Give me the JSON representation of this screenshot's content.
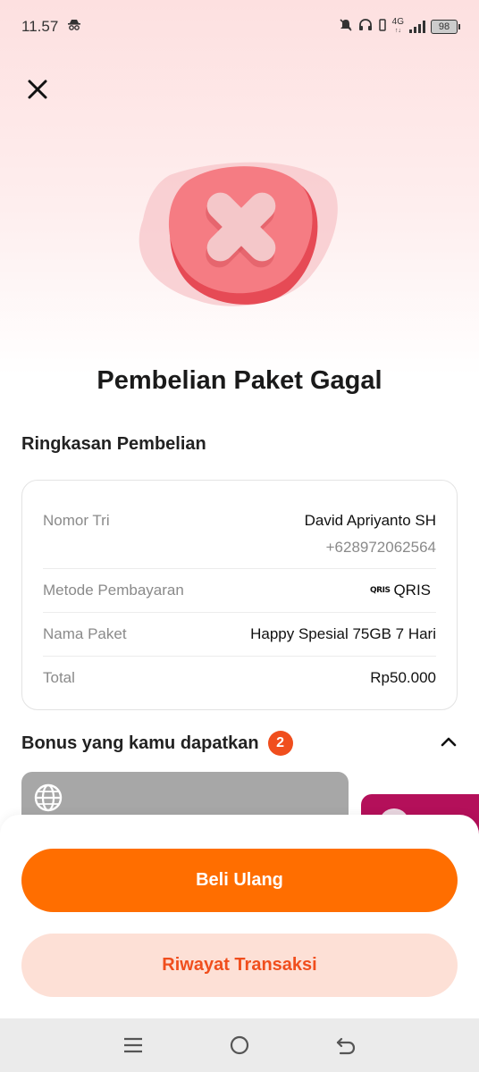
{
  "status_bar": {
    "time": "11.57",
    "network": "4G",
    "battery": "98"
  },
  "page": {
    "title": "Pembelian Paket Gagal"
  },
  "summary": {
    "section_title": "Ringkasan Pembelian",
    "rows": [
      {
        "label": "Nomor Tri",
        "value": "David Apriyanto SH",
        "sub_value": "+628972062564"
      },
      {
        "label": "Metode Pembayaran",
        "value": "QRIS",
        "logo_text": "QRIS"
      },
      {
        "label": "Nama Paket",
        "value": "Happy Spesial 75GB 7 Hari"
      },
      {
        "label": "Total",
        "value": "Rp50.000"
      }
    ]
  },
  "bonus": {
    "title": "Bonus yang kamu dapatkan",
    "count": "2"
  },
  "actions": {
    "primary_label": "Beli Ulang",
    "secondary_label": "Riwayat Transaksi"
  },
  "icons": {
    "close": "close-icon",
    "hero": "failed-x-icon",
    "chevron": "chevron-up-icon",
    "globe": "globe-icon"
  },
  "colors": {
    "primary": "#ff6e00",
    "secondary_bg": "#fde0d6",
    "secondary_text": "#f04e1d",
    "badge": "#f04e1d",
    "error": "#e84a55"
  }
}
